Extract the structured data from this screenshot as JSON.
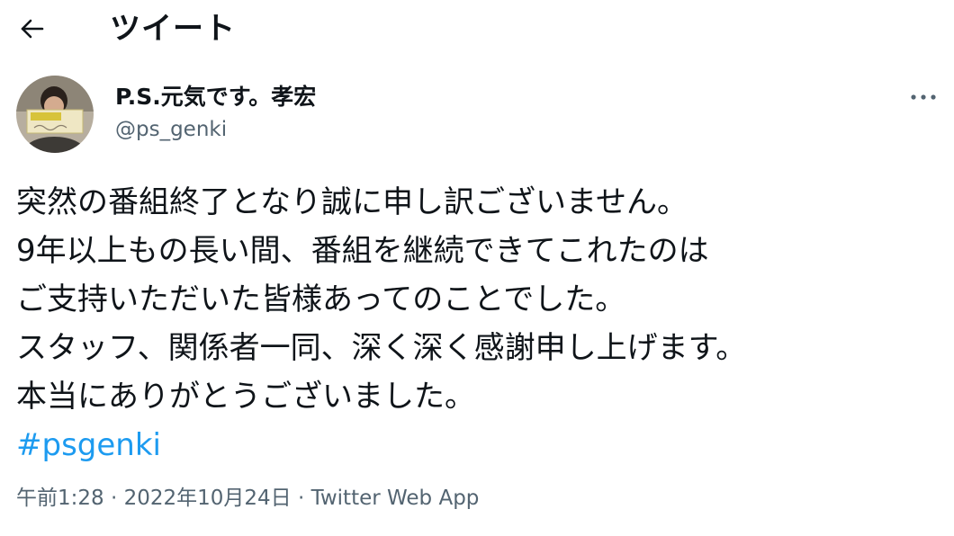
{
  "header": {
    "back_icon": "arrow-left-icon",
    "title": "ツイート"
  },
  "author": {
    "display_name": "P.S.元気です。孝宏",
    "handle": "@ps_genki",
    "avatar_icon": "profile-photo"
  },
  "more_icon": "more-horizontal-icon",
  "tweet": {
    "lines": [
      "突然の番組終了となり誠に申し訳ございません。",
      "9年以上もの長い間、番組を継続できてこれたのは",
      "ご支持いただいた皆様あってのことでした。",
      "スタッフ、関係者一同、深く深く感謝申し上げます。",
      "本当にありがとうございました。"
    ],
    "hashtag": "#psgenki"
  },
  "meta": {
    "time": "午前1:28",
    "separator": " · ",
    "date": "2022年10月24日",
    "source": "Twitter Web App"
  },
  "colors": {
    "text": "#0f1419",
    "secondary": "#536471",
    "link": "#1d9bf0"
  }
}
